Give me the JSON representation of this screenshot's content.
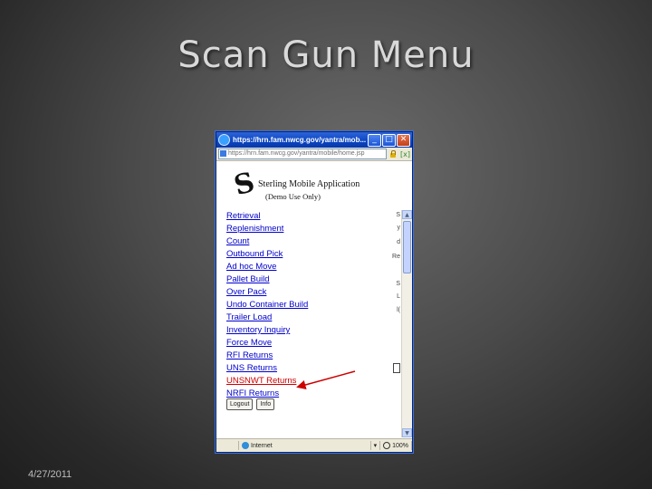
{
  "slide": {
    "title": "Scan Gun Menu",
    "date": "4/27/2011"
  },
  "browser": {
    "window_title": "https://hrn.fam.nwcg.gov/yantra/mob...",
    "address": "https://hrn.fam.nwcg.gov/yantra/mobile/home.jsp",
    "buttons": {
      "minimize": "_",
      "maximize": "□",
      "close": "✕"
    },
    "status": {
      "zone": "Internet",
      "zoom": "100%"
    }
  },
  "app": {
    "logo": "S",
    "title": "Sterling Mobile Application",
    "subtitle": "(Demo Use Only)",
    "menu": [
      "Retrieval",
      "Replenishment",
      "Count",
      "Outbound Pick",
      "Ad hoc Move",
      "Pallet Build",
      "Over Pack",
      "Undo Container Build",
      "Trailer Load",
      "Inventory Inquiry",
      "Force Move",
      "RFI Returns",
      "UNS Returns",
      "UNSNWT Returns",
      "NRFI Returns"
    ],
    "highlighted_item": "UNSNWT Returns",
    "logout_label": "Logout",
    "info_label": "Info"
  },
  "side_fragments": [
    "S",
    "y",
    "d",
    "Re",
    "S",
    "L",
    "l("
  ],
  "colors": {
    "link": "#0000cc",
    "highlight": "#cc0000",
    "arrow": "#cc0000",
    "titlebar": "#0a45c2"
  }
}
